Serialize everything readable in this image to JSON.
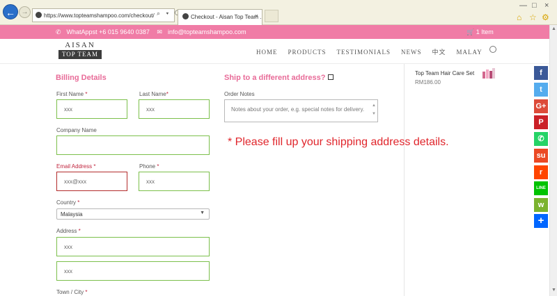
{
  "browser": {
    "back_label": "←",
    "forward_label": "→",
    "url": "https://www.topteamshampoo.com/checkout/",
    "url_actions": "⌕ ▾ ⟳",
    "tab_title": "Checkout - Aisan Top Team ...",
    "tab_close": "×",
    "window_controls": [
      "—",
      "□",
      "×"
    ],
    "toolbar_icons": [
      "⌂",
      "☆",
      "⚙"
    ]
  },
  "topbar": {
    "whatsapp": "WhatAppst +6 015 9640 0387",
    "email": "info@topteamshampoo.com",
    "cart": "1 Item",
    "bg_color": "#f07ca6"
  },
  "header": {
    "logo_line1": "AISAN",
    "logo_line2": "TOP TEAM",
    "nav": [
      "HOME",
      "PRODUCTS",
      "TESTIMONIALS",
      "NEWS",
      "中文",
      "MALAY"
    ]
  },
  "billing": {
    "heading": "Billing Details",
    "first_name": {
      "label": "First Name",
      "required": "*",
      "value": "xxx"
    },
    "last_name": {
      "label": "Last Name",
      "required": "*",
      "value": "xxx"
    },
    "company": {
      "label": "Company Name",
      "value": ""
    },
    "email": {
      "label": "Email Address",
      "required": "*",
      "value": "xxx@xxx"
    },
    "phone": {
      "label": "Phone",
      "required": "*",
      "value": "xxx"
    },
    "country": {
      "label": "Country",
      "required": "*",
      "value": "Malaysia",
      "caret": "▼"
    },
    "address": {
      "label": "Address",
      "required": "*",
      "line1": "xxx",
      "line2": "xxx"
    },
    "town": {
      "label": "Town / City",
      "required": "*"
    }
  },
  "shipping": {
    "heading": "Ship to a different address?",
    "order_notes_label": "Order Notes",
    "order_notes_placeholder": "Notes about your order, e.g. special notes for delivery.",
    "notice": "* Please fill up your shipping address details."
  },
  "cart_item": {
    "name": "Top Team Hair Care Set",
    "price": "RM186.00"
  },
  "share_buttons": [
    {
      "name": "facebook",
      "glyph": "f",
      "color": "#3b5998"
    },
    {
      "name": "twitter",
      "glyph": "t",
      "color": "#55acee"
    },
    {
      "name": "google-plus",
      "glyph": "G+",
      "color": "#dd4b39"
    },
    {
      "name": "pinterest",
      "glyph": "P",
      "color": "#cb2027"
    },
    {
      "name": "whatsapp",
      "glyph": "✆",
      "color": "#25d366"
    },
    {
      "name": "stumbleupon",
      "glyph": "su",
      "color": "#eb4924"
    },
    {
      "name": "reddit",
      "glyph": "r",
      "color": "#ff4500"
    },
    {
      "name": "line",
      "glyph": "LINE",
      "color": "#00c300"
    },
    {
      "name": "wechat",
      "glyph": "w",
      "color": "#7bb32e"
    },
    {
      "name": "share",
      "glyph": "+",
      "color": "#0166ff"
    }
  ]
}
